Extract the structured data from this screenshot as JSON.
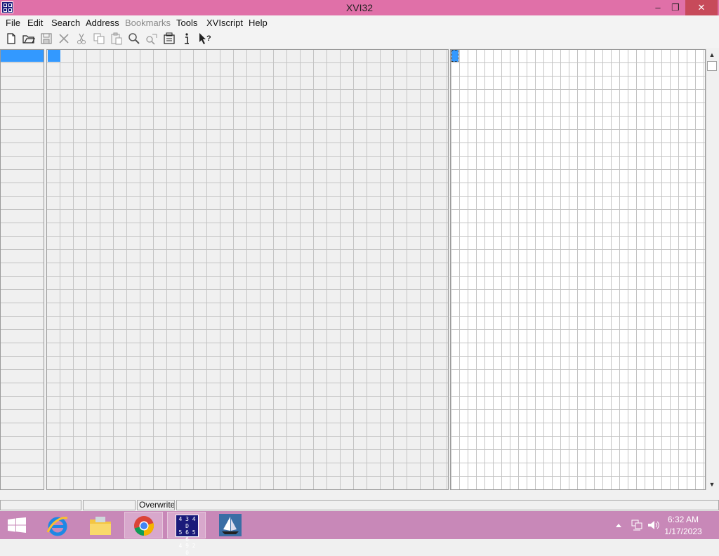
{
  "window": {
    "title": "XVI32",
    "minimize": "–",
    "restore": "❐",
    "close": "✕"
  },
  "menu": [
    {
      "label": "File",
      "enabled": true
    },
    {
      "label": "Edit",
      "enabled": true
    },
    {
      "label": "Search",
      "enabled": true
    },
    {
      "label": "Address",
      "enabled": true
    },
    {
      "label": "Bookmarks",
      "enabled": false
    },
    {
      "label": "Tools",
      "enabled": true
    },
    {
      "label": "XVIscript",
      "enabled": true
    },
    {
      "label": "Help",
      "enabled": true
    }
  ],
  "toolbar": {
    "icons": [
      "new-file-icon",
      "open-folder-icon",
      "save-icon",
      "close-file-icon",
      "cut-icon",
      "copy-icon",
      "paste-icon",
      "find-icon",
      "replace-icon",
      "properties-icon",
      "info-icon",
      "help-pointer-icon"
    ]
  },
  "editor": {
    "selection_color": "#3399ff"
  },
  "statusbar": {
    "panels": [
      "",
      "",
      "Overwrite",
      ""
    ]
  },
  "taskbar": {
    "apps": [
      "internet-explorer-icon",
      "file-explorer-icon",
      "chrome-icon",
      "xvi32-icon",
      "sailboat-icon"
    ],
    "xvi32_icon_rows": [
      "4 3 4 D",
      "5 6 5 6",
      "4 9 2 0"
    ],
    "time": "6:32 AM",
    "date": "1/17/2023"
  },
  "colors": {
    "titlebar": "#e070a8",
    "taskbar": "#c888b8",
    "accent": "#3399ff"
  }
}
